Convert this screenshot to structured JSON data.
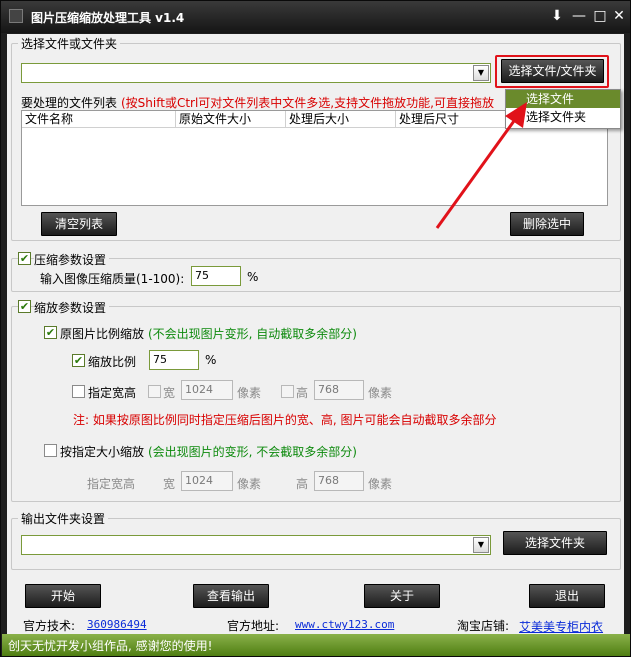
{
  "window": {
    "title": "图片压缩缩放处理工具 v1.4",
    "controls": [
      "⬇",
      "—",
      "□",
      "✕"
    ]
  },
  "file_section": {
    "label": "选择文件或文件夹",
    "path_value": "",
    "select_button": "选择文件/文件夹",
    "menu": [
      "选择文件",
      "选择文件夹"
    ]
  },
  "file_list": {
    "label": "要处理的文件列表",
    "hint": "(按Shift或Ctrl可对文件列表中文件多选,支持文件拖放功能,可直接拖放",
    "columns": [
      "文件名称",
      "原始文件大小",
      "处理后大小",
      "处理后尺寸"
    ],
    "clear_button": "清空列表",
    "delete_button": "删除选中"
  },
  "compress": {
    "label": "压缩参数设置",
    "checked": true,
    "quality_label": "输入图像压缩质量(1-100):",
    "quality_value": "75",
    "unit": "%"
  },
  "scale": {
    "label": "缩放参数设置",
    "checked": true,
    "keep_ratio": {
      "label": "原图片比例缩放",
      "note": "(不会出现图片变形, 自动截取多余部分)",
      "checked": true
    },
    "ratio": {
      "label": "缩放比例",
      "value": "75",
      "unit": "%",
      "checked": true
    },
    "fixed": {
      "label": "指定宽高",
      "checked": false,
      "width_label": "宽",
      "width": "1024",
      "px": "像素",
      "height_label": "高",
      "height": "768"
    },
    "warning": "注: 如果按原图比例同时指定压缩后图片的宽、高, 图片可能会自动截取多余部分",
    "by_size": {
      "label": "按指定大小缩放",
      "note": "(会出现图片的变形, 不会截取多余部分)",
      "checked": false
    },
    "size": {
      "label": "指定宽高",
      "width_label": "宽",
      "width": "1024",
      "px": "像素",
      "height_label": "高",
      "height": "768"
    }
  },
  "output": {
    "label": "输出文件夹设置",
    "path_value": "",
    "select_button": "选择文件夹"
  },
  "buttons": {
    "start": "开始",
    "view_output": "查看输出",
    "about": "关于",
    "exit": "退出"
  },
  "footer": {
    "tech_label": "官方技术:",
    "tech_value": "360986494",
    "site_label": "官方地址:",
    "site_value": "www.ctwy123.com",
    "shop_label": "淘宝店铺:",
    "shop_value": "艾美美专柜内衣"
  },
  "status": "创天无忧开发小组作品, 感谢您的使用!",
  "colors": {
    "highlight": "#e1121a",
    "arrow": "#e1121a",
    "menu_selected": "#6a8a2c",
    "green_text": "#0d8a0d"
  }
}
